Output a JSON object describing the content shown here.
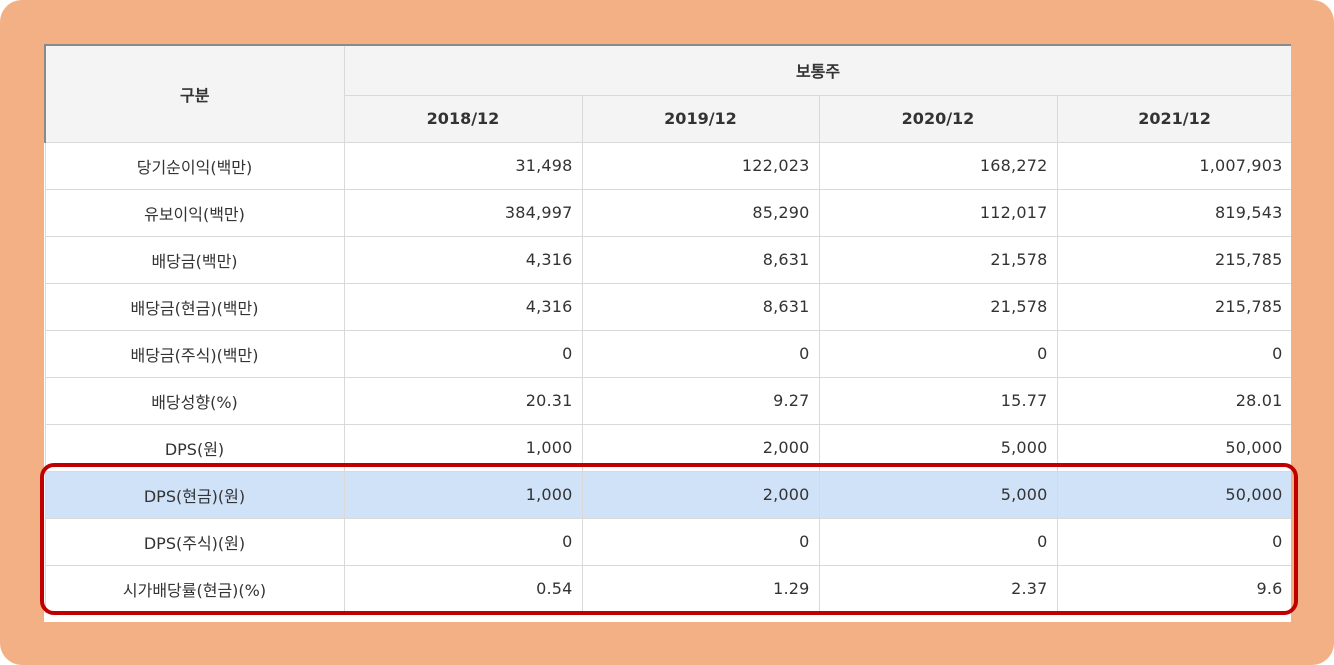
{
  "table": {
    "corner_label": "구분",
    "group_label": "보통주",
    "columns": [
      "2018/12",
      "2019/12",
      "2020/12",
      "2021/12"
    ],
    "rows": [
      {
        "label": "당기순이익(백만)",
        "values": [
          "31,498",
          "122,023",
          "168,272",
          "1,007,903"
        ]
      },
      {
        "label": "유보이익(백만)",
        "values": [
          "384,997",
          "85,290",
          "112,017",
          "819,543"
        ]
      },
      {
        "label": "배당금(백만)",
        "values": [
          "4,316",
          "8,631",
          "21,578",
          "215,785"
        ]
      },
      {
        "label": "배당금(현금)(백만)",
        "values": [
          "4,316",
          "8,631",
          "21,578",
          "215,785"
        ]
      },
      {
        "label": "배당금(주식)(백만)",
        "values": [
          "0",
          "0",
          "0",
          "0"
        ]
      },
      {
        "label": "배당성향(%)",
        "values": [
          "20.31",
          "9.27",
          "15.77",
          "28.01"
        ]
      },
      {
        "label": "DPS(원)",
        "values": [
          "1,000",
          "2,000",
          "5,000",
          "50,000"
        ]
      },
      {
        "label": "DPS(현금)(원)",
        "values": [
          "1,000",
          "2,000",
          "5,000",
          "50,000"
        ]
      },
      {
        "label": "DPS(주식)(원)",
        "values": [
          "0",
          "0",
          "0",
          "0"
        ]
      },
      {
        "label": "시가배당률(현금)(%)",
        "values": [
          "0.54",
          "1.29",
          "2.37",
          "9.6"
        ]
      }
    ],
    "highlighted_row_label": "DPS(현금)(원)"
  },
  "colors": {
    "frame": "#f3b084",
    "highlight_row": "#cfe2f8",
    "annotation_box": "#c00000",
    "header_bg": "#f4f4f4"
  }
}
